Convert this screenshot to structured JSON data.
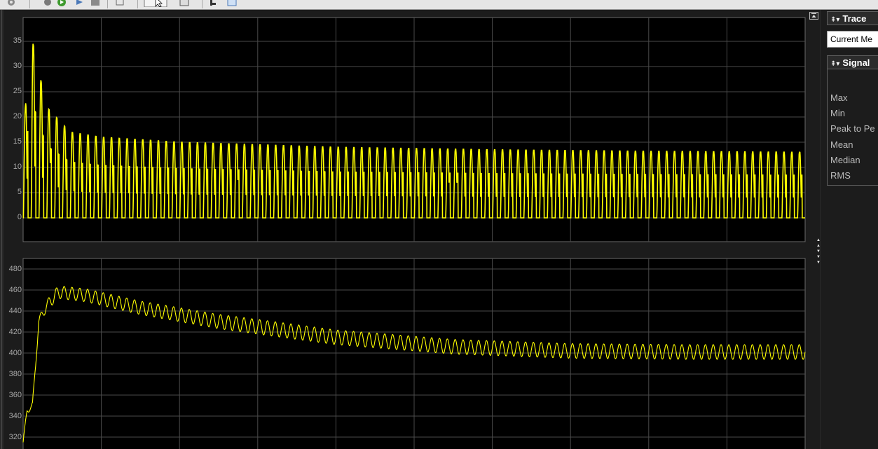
{
  "toolbar": {
    "icons": [
      "settings-icon",
      "step-back-icon",
      "run-icon",
      "step-forward-icon",
      "stop-icon",
      "layout-icon",
      "select-icon",
      "zoom-icon",
      "cursor-measure-icon",
      "style-icon"
    ]
  },
  "scope": {
    "top_axis": {
      "ticks": [
        "35",
        "30",
        "25",
        "20",
        "15",
        "10",
        "5",
        "0"
      ]
    },
    "bottom_axis": {
      "ticks": [
        "480",
        "460",
        "440",
        "420",
        "400",
        "380",
        "360",
        "340",
        "320"
      ]
    },
    "trace_color": "#ffff00",
    "grid_color": "#4a4a4a",
    "background": "#000000"
  },
  "chart_data": [
    {
      "type": "line",
      "title": "",
      "xlabel": "",
      "ylabel": "",
      "ylim": [
        -5,
        40
      ],
      "grid": true,
      "series": [
        {
          "color": "#ffff00",
          "description": "rectified oscillating signal, min 0",
          "peak_envelope": [
            [
              0.0,
              18
            ],
            [
              0.012,
              35
            ],
            [
              0.03,
              22
            ],
            [
              0.06,
              17
            ],
            [
              0.1,
              16
            ],
            [
              0.2,
              15
            ],
            [
              0.4,
              14
            ],
            [
              0.6,
              13.5
            ],
            [
              0.8,
              13.2
            ],
            [
              1.0,
              13
            ]
          ],
          "trough_envelope": [
            [
              0.0,
              0
            ],
            [
              1.0,
              0
            ]
          ],
          "cycles": 100
        }
      ]
    },
    {
      "type": "line",
      "title": "",
      "xlabel": "",
      "ylabel": "",
      "ylim": [
        310,
        490
      ],
      "grid": true,
      "series": [
        {
          "color": "#ffff00",
          "description": "DC level with ripple",
          "mean_envelope": [
            [
              0.0,
              315
            ],
            [
              0.005,
              345
            ],
            [
              0.012,
              350
            ],
            [
              0.02,
              430
            ],
            [
              0.03,
              445
            ],
            [
              0.045,
              458
            ],
            [
              0.08,
              455
            ],
            [
              0.15,
              443
            ],
            [
              0.25,
              430
            ],
            [
              0.4,
              415
            ],
            [
              0.55,
              406
            ],
            [
              0.7,
              402
            ],
            [
              0.85,
              401
            ],
            [
              1.0,
              401
            ]
          ],
          "ripple_amplitude": [
            [
              0.0,
              2
            ],
            [
              0.04,
              6
            ],
            [
              0.3,
              7
            ],
            [
              1.0,
              7
            ]
          ],
          "cycles": 100
        }
      ]
    }
  ],
  "right_panel": {
    "trace_header": "Trace",
    "trace_dropdown_value": "Current Me",
    "signal_header": "Signal",
    "stats": [
      "Max",
      "Min",
      "Peak to Pe",
      "Mean",
      "Median",
      "RMS"
    ]
  }
}
